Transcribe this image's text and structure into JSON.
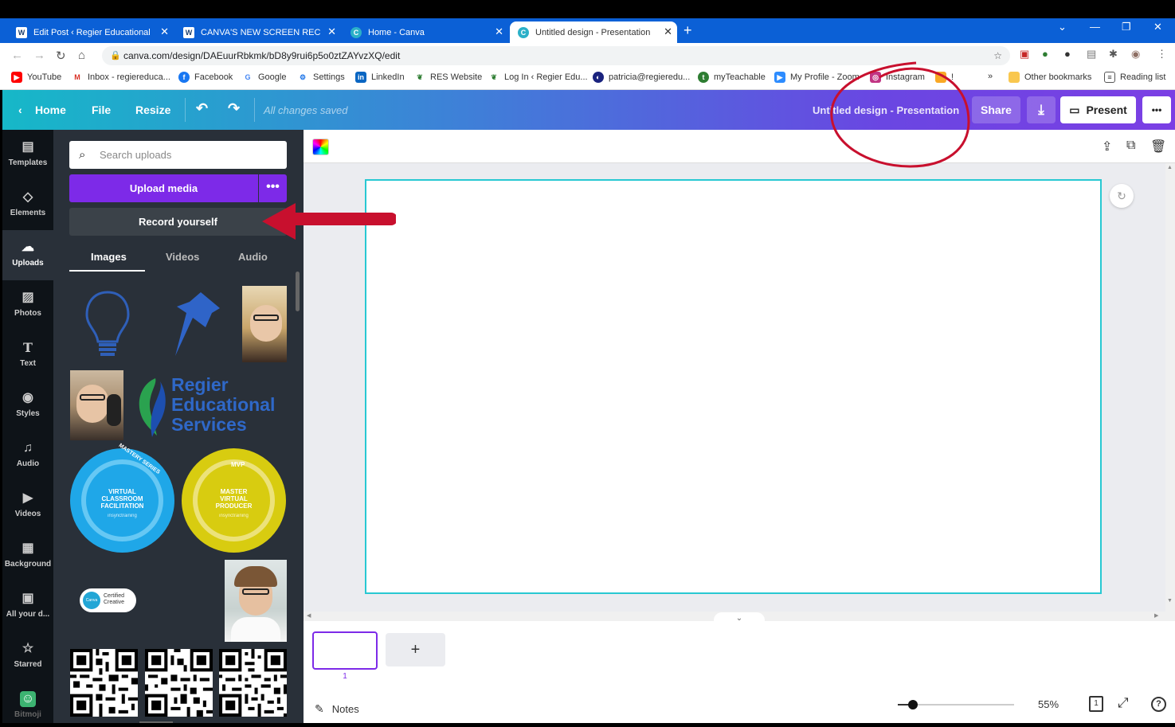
{
  "browser": {
    "tabs": [
      {
        "title": "Edit Post ‹ Regier Educational Se",
        "active": false
      },
      {
        "title": "CANVA'S NEW SCREEN RECORDI",
        "active": false
      },
      {
        "title": "Home - Canva",
        "active": false
      },
      {
        "title": "Untitled design - Presentation",
        "active": true
      }
    ],
    "url": "canva.com/design/DAEuurRbkmk/bD8y9rui6p5o0ztZAYvzXQ/edit",
    "bookmarks": [
      {
        "label": "YouTube",
        "color": "#ff0000"
      },
      {
        "label": "Inbox - regiereduca...",
        "color": "#d93025"
      },
      {
        "label": "Facebook",
        "color": "#1877f2"
      },
      {
        "label": "Google",
        "color": "#4285f4"
      },
      {
        "label": "Settings",
        "color": "#1a73e8"
      },
      {
        "label": "LinkedIn",
        "color": "#0a66c2"
      },
      {
        "label": "RES Website",
        "color": "#2e7d32"
      },
      {
        "label": "Log In ‹ Regier Edu...",
        "color": "#2e7d32"
      },
      {
        "label": "patricia@regieredu...",
        "color": "#1a237e"
      },
      {
        "label": "myTeachable",
        "color": "#2e7d32"
      },
      {
        "label": "My Profile - Zoom",
        "color": "#2d8cff"
      },
      {
        "label": "Instagram",
        "color": "#c13584"
      },
      {
        "label": "!",
        "color": "#f9a825"
      }
    ],
    "other_bookmarks": "Other bookmarks",
    "reading_list": "Reading list",
    "overflow": "»"
  },
  "canva": {
    "home": "Home",
    "file": "File",
    "resize": "Resize",
    "saved": "All changes saved",
    "title": "Untitled design - Presentation",
    "share": "Share",
    "present": "Present",
    "more": "•••"
  },
  "sidebar": [
    {
      "label": "Templates",
      "icon": "▤"
    },
    {
      "label": "Elements",
      "icon": "◇"
    },
    {
      "label": "Uploads",
      "icon": "☁"
    },
    {
      "label": "Photos",
      "icon": "▨"
    },
    {
      "label": "Text",
      "icon": "T"
    },
    {
      "label": "Styles",
      "icon": "◉"
    },
    {
      "label": "Audio",
      "icon": "♫"
    },
    {
      "label": "Videos",
      "icon": "▶"
    },
    {
      "label": "Background",
      "icon": "▦"
    },
    {
      "label": "All your d...",
      "icon": "▣"
    },
    {
      "label": "Starred",
      "icon": "☆"
    },
    {
      "label": "Bitmoji",
      "icon": "☺"
    }
  ],
  "panel": {
    "search_placeholder": "Search uploads",
    "upload_media": "Upload media",
    "more": "•••",
    "record_yourself": "Record yourself",
    "tabs": [
      "Images",
      "Videos",
      "Audio"
    ],
    "logo_lines": [
      "Regier",
      "Educational",
      "Services"
    ],
    "badge1": {
      "lines": [
        "VIRTUAL",
        "CLASSROOM",
        "FACILITATION"
      ],
      "arc": "MASTERY SERIES",
      "brand": "insynctraining",
      "color": "#1fa7e8"
    },
    "badge2": {
      "lines": [
        "MASTER",
        "VIRTUAL",
        "PRODUCER"
      ],
      "arc": "MVP",
      "brand": "insynctraining",
      "color": "#d8cc10"
    },
    "certified": [
      "Certified",
      "Creative"
    ],
    "canva_mark": "Canva"
  },
  "editor": {
    "page_number": "1",
    "add_page": "+",
    "notes": "Notes",
    "zoom": "55%",
    "page_indicator": "1",
    "help": "?",
    "zoom_fraction": 0.08
  },
  "colors": {
    "accent": "#7d2ae8",
    "slide_border": "#28c8d2",
    "annotation": "#c8102e"
  }
}
